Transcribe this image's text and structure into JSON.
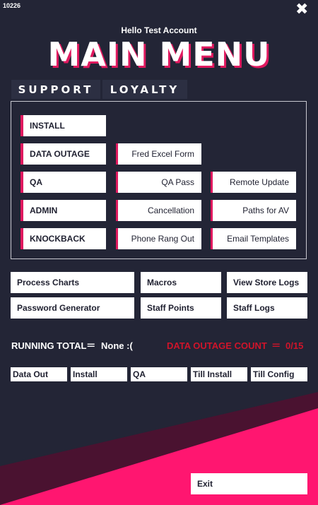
{
  "window": {
    "id_text": "10226",
    "close_glyph": "✖"
  },
  "header": {
    "greeting": "Hello Test Account",
    "title": "MAIN MENU"
  },
  "tabs": [
    "SUPPORT",
    "LOYALTY"
  ],
  "main_panel": {
    "left_buttons": [
      "INSTALL",
      "DATA OUTAGE",
      "QA",
      "ADMIN",
      "KNOCKBACK"
    ],
    "mid_buttons": [
      "Fred Excel Form",
      "QA Pass",
      "Cancellation",
      "Phone Rang Out"
    ],
    "right_buttons": [
      "Remote Update",
      "Paths for AV",
      "Email Templates"
    ]
  },
  "tools": {
    "row1": [
      "Process Charts",
      "Macros",
      "View Store Logs"
    ],
    "row2": [
      "Password Generator",
      "Staff Points",
      "Staff Logs"
    ]
  },
  "stats": {
    "running_total_label": "RUNNING TOTAL",
    "running_total_eq": "=",
    "running_total_value": "None :(",
    "outage_label": "DATA OUTAGE COUNT",
    "outage_eq": "=",
    "outage_value": "0/15"
  },
  "bottom_buttons": [
    "Data Out",
    "Install",
    "QA",
    "Till Install",
    "Till Config"
  ],
  "exit_label": "Exit",
  "colors": {
    "background": "#232536",
    "accent": "#e0195f",
    "dark_accent": "#4a1230",
    "outage_red": "#d0142a"
  }
}
